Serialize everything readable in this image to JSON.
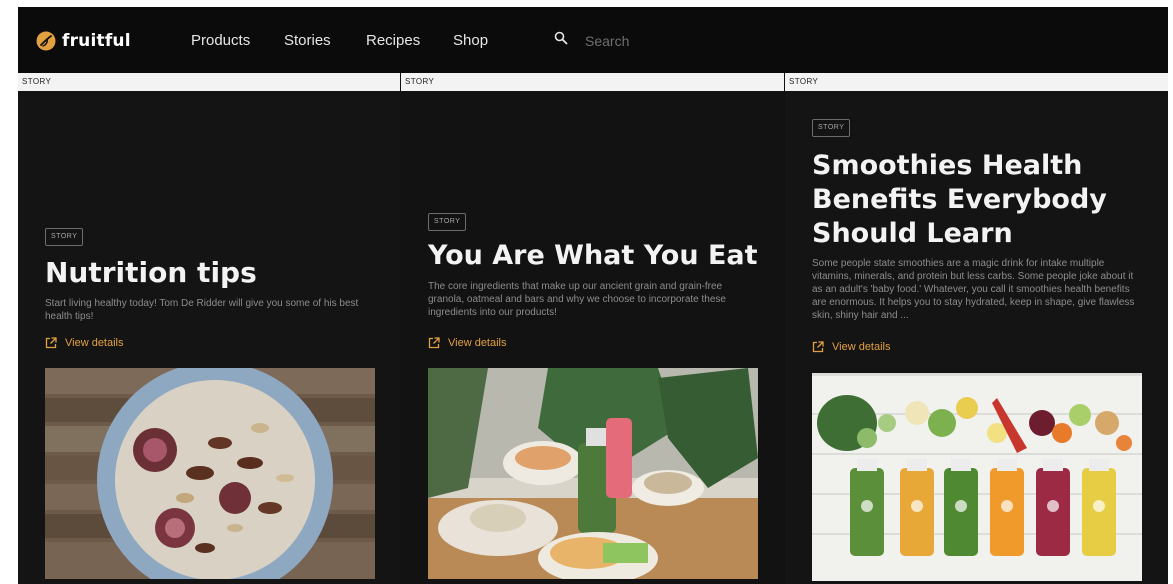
{
  "nav": {
    "brand": "fruitful",
    "links": [
      {
        "label": "Products"
      },
      {
        "label": "Stories"
      },
      {
        "label": "Recipes"
      },
      {
        "label": "Shop"
      }
    ],
    "search_placeholder": "Search"
  },
  "stories": [
    {
      "bar_label": "STORY",
      "tag": "STORY",
      "title": "Nutrition tips",
      "description": "Start living healthy today! Tom De Ridder will give you some of his best health tips!",
      "cta": "View details",
      "image_icon": "muesli-bowl-photo"
    },
    {
      "bar_label": "STORY",
      "tag": "STORY",
      "title": "You Are What You Eat",
      "description": "The core ingredients that make up our ancient grain and grain-free granola, oatmeal and bars and why we choose to incorporate these ingredients into our products!",
      "cta": "View details",
      "image_icon": "healthy-lunch-photo"
    },
    {
      "bar_label": "STORY",
      "tag": "STORY",
      "title": "Smoothies Health Benefits Everybody Should Learn",
      "description": "Some people state smoothies are a magic drink for intake multiple vitamins, minerals, and protein but less carbs. Some people joke about it as an adult's 'baby food.' Whatever, you call it smoothies health benefits are enormous. It helps you to stay hydrated, keep in shape, give flawless skin, shiny hair and ...",
      "cta": "View details",
      "image_icon": "smoothie-bottles-photo"
    }
  ],
  "colors": {
    "accent": "#e3a040",
    "background": "#111111",
    "text": "#f3f3f3"
  }
}
